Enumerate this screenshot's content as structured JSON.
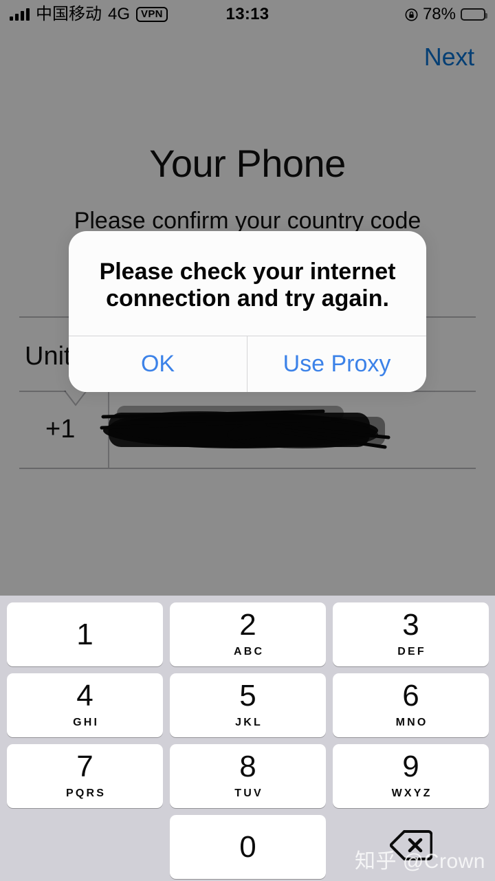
{
  "status_bar": {
    "carrier": "中国移动",
    "network": "4G",
    "vpn_badge": "VPN",
    "time": "13:13",
    "battery_percent": "78%",
    "signal_icon": "signal-bars-icon",
    "rotation_lock_icon": "rotation-lock-icon",
    "battery_icon": "battery-icon",
    "battery_level": 78
  },
  "nav": {
    "next_label": "Next",
    "next_color": "#0a74d4"
  },
  "main": {
    "title": "Your Phone",
    "subtitle": "Please confirm your country code",
    "country_name": "United States",
    "country_name_visible": "Unit",
    "country_code": "+1",
    "phone_number": "",
    "phone_number_redacted": true
  },
  "alert": {
    "message": "Please check your internet connection and try again.",
    "buttons": [
      {
        "label": "OK",
        "name": "alert-ok-button"
      },
      {
        "label": "Use Proxy",
        "name": "alert-use-proxy-button"
      }
    ],
    "button_color": "#3c82e8"
  },
  "keypad": {
    "background_color": "#d1d0d7",
    "rows": [
      [
        {
          "digit": "1",
          "letters": ""
        },
        {
          "digit": "2",
          "letters": "ABC"
        },
        {
          "digit": "3",
          "letters": "DEF"
        }
      ],
      [
        {
          "digit": "4",
          "letters": "GHI"
        },
        {
          "digit": "5",
          "letters": "JKL"
        },
        {
          "digit": "6",
          "letters": "MNO"
        }
      ],
      [
        {
          "digit": "7",
          "letters": "PQRS"
        },
        {
          "digit": "8",
          "letters": "TUV"
        },
        {
          "digit": "9",
          "letters": "WXYZ"
        }
      ],
      [
        {
          "digit": "0",
          "letters": ""
        }
      ]
    ],
    "delete_icon": "delete-backspace-icon"
  },
  "watermark": {
    "text": "知乎 @Crown"
  }
}
